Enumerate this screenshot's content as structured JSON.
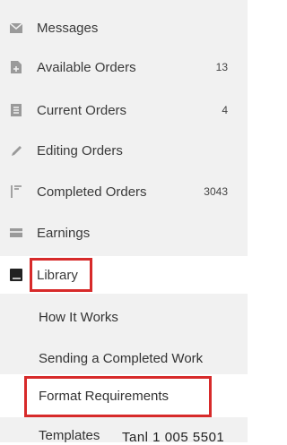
{
  "sidebar": {
    "items": [
      {
        "label": "Messages",
        "count": "",
        "icon": "envelope-icon"
      },
      {
        "label": "Available Orders",
        "count": "13",
        "icon": "document-plus-icon"
      },
      {
        "label": "Current Orders",
        "count": "4",
        "icon": "list-icon"
      },
      {
        "label": "Editing Orders",
        "count": "",
        "icon": "pencil-icon"
      },
      {
        "label": "Completed Orders",
        "count": "3043",
        "icon": "flag-icon"
      },
      {
        "label": "Earnings",
        "count": "",
        "icon": "wallet-icon"
      },
      {
        "label": "Library",
        "count": "",
        "icon": "book-icon"
      }
    ],
    "library_subitems": [
      {
        "label": "How It Works"
      },
      {
        "label": "Sending a Completed Work"
      },
      {
        "label": "Format Requirements"
      },
      {
        "label": "Templates"
      }
    ]
  },
  "overlay_text": "Tanl 1 005 5501",
  "colors": {
    "highlight": "#d72a2a",
    "sidebar_bg": "#f1f1f1",
    "icon": "#9a9a9a"
  }
}
